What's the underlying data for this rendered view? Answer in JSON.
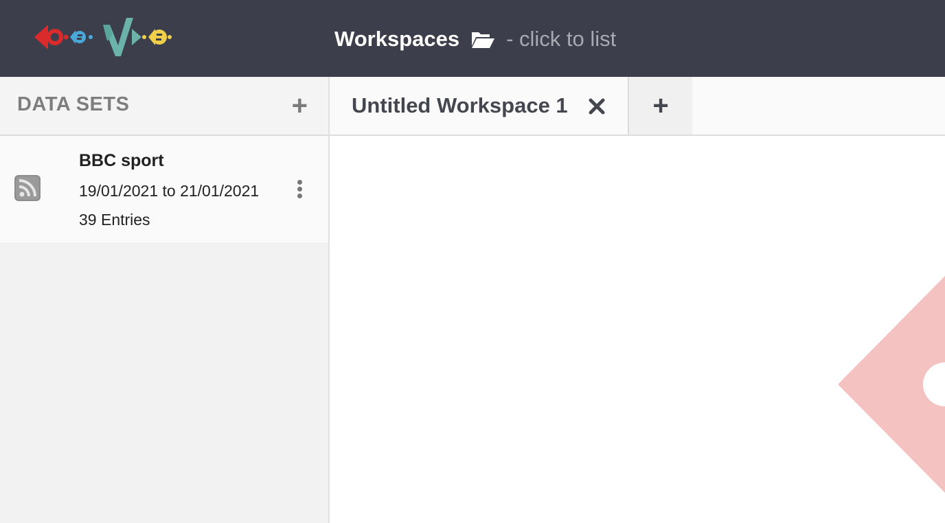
{
  "header": {
    "title": "Workspaces",
    "hint": "- click to list",
    "logo_icon": "cosmos-logo",
    "folder_icon": "folder-open-icon"
  },
  "sidebar": {
    "title": "DATA SETS",
    "add_label": "+",
    "datasets": [
      {
        "name": "BBC sport",
        "date_range": "19/01/2021 to 21/01/2021",
        "entries": "39 Entries",
        "icon": "rss-icon"
      }
    ]
  },
  "tabs": {
    "items": [
      {
        "label": "Untitled Workspace 1",
        "close_icon": "close-icon"
      }
    ],
    "add_label": "+"
  },
  "colors": {
    "topbar": "#3c3e4b",
    "logo_red": "#d92b2b",
    "logo_blue": "#4aa8d8",
    "logo_teal": "#6bb3aa",
    "logo_yellow": "#f0d04a",
    "watermark": "#f4c2c0"
  }
}
